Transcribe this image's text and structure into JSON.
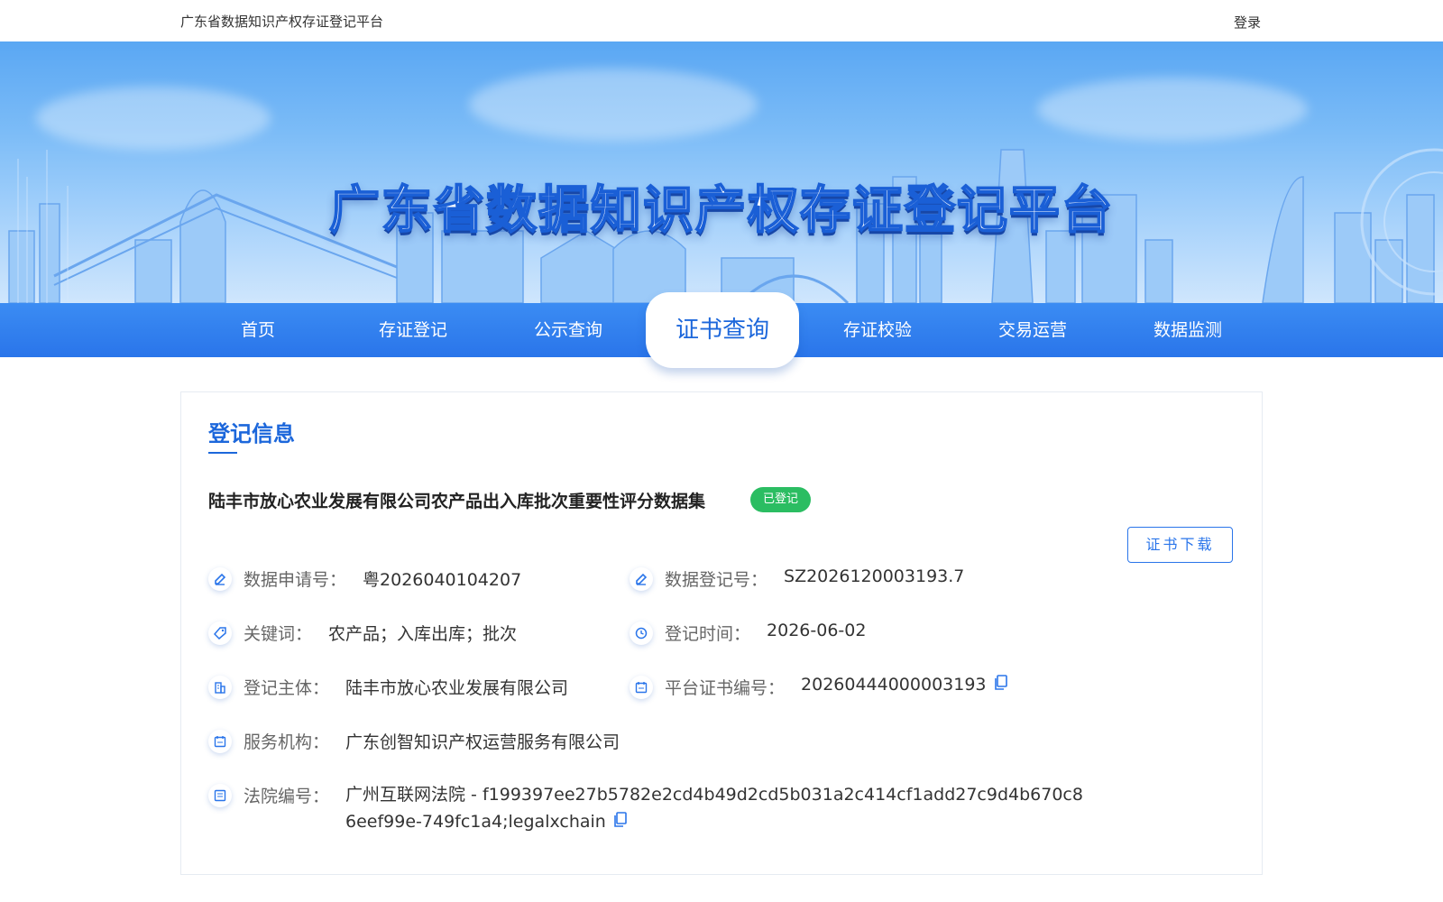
{
  "topbar": {
    "site_name": "广东省数据知识产权存证登记平台",
    "login_label": "登录"
  },
  "banner": {
    "title": "广东省数据知识产权存证登记平台"
  },
  "nav": {
    "items": [
      {
        "label": "首页",
        "active": false
      },
      {
        "label": "存证登记",
        "active": false
      },
      {
        "label": "公示查询",
        "active": false
      },
      {
        "label": "证书查询",
        "active": true
      },
      {
        "label": "存证校验",
        "active": false
      },
      {
        "label": "交易运营",
        "active": false
      },
      {
        "label": "数据监测",
        "active": false
      }
    ]
  },
  "registration": {
    "section_title": "登记信息",
    "dataset_name": "陆丰市放心农业发展有限公司农产品出入库批次重要性评分数据集",
    "status": "已登记",
    "download_label": "证书下载",
    "fields": {
      "application_no": {
        "label": "数据申请号：",
        "value": "粤2026040104207",
        "icon": "edit-icon"
      },
      "registration_no": {
        "label": "数据登记号：",
        "value": "SZ2026120003193.7",
        "icon": "edit-icon"
      },
      "keywords": {
        "label": "关键词：",
        "value": "农产品；入库出库；批次",
        "icon": "tag-icon"
      },
      "registration_time": {
        "label": "登记时间：",
        "value": "2026-06-02",
        "icon": "clock-icon"
      },
      "registrant": {
        "label": "登记主体：",
        "value": "陆丰市放心农业发展有限公司",
        "icon": "building-icon"
      },
      "certificate_no": {
        "label": "平台证书编号：",
        "value": "20260444000003193",
        "icon": "calendar-icon"
      },
      "service_agency": {
        "label": "服务机构：",
        "value": "广东创智知识产权运营服务有限公司",
        "icon": "calendar-icon"
      },
      "court_no": {
        "label": "法院编号：",
        "value": "广州互联网法院 - f199397ee27b5782e2cd4b49d2cd5b031a2c414cf1add27c9d4b670c86eef99e-749fc1a4;legalxchain",
        "icon": "list-icon"
      }
    }
  },
  "colors": {
    "primary": "#1c67db",
    "nav_bg": "#2a75ea",
    "status_green": "#2bbd62"
  }
}
